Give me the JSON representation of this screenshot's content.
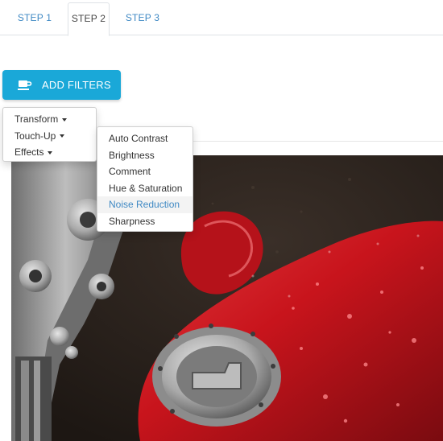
{
  "tabs": [
    {
      "label": "STEP 1"
    },
    {
      "label": "STEP 2"
    },
    {
      "label": "STEP 3"
    }
  ],
  "active_tab": "STEP 2",
  "add_filters": {
    "label": "ADD FILTERS",
    "icon": "coffee-cup-icon"
  },
  "filter_menu": {
    "categories": [
      {
        "label": "Transform"
      },
      {
        "label": "Touch-Up"
      },
      {
        "label": "Effects"
      }
    ],
    "submenu_items": [
      {
        "label": "Auto Contrast"
      },
      {
        "label": "Brightness"
      },
      {
        "label": "Comment"
      },
      {
        "label": "Hue & Saturation"
      },
      {
        "label": "Noise Reduction"
      },
      {
        "label": "Sharpness"
      }
    ],
    "highlighted_item": "Noise Reduction"
  },
  "colors": {
    "accent": "#1aa8d8",
    "link": "#3f89c4",
    "photo_red": "#c8141c"
  }
}
